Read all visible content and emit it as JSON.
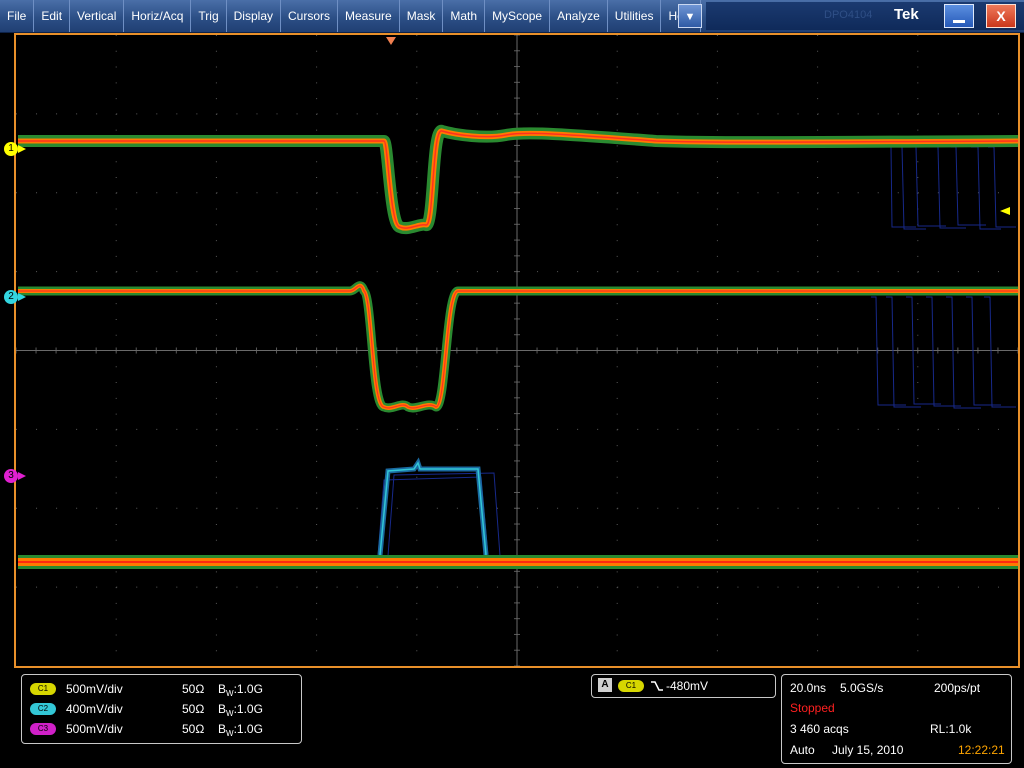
{
  "menu": {
    "items": [
      "File",
      "Edit",
      "Vertical",
      "Horiz/Acq",
      "Trig",
      "Display",
      "Cursors",
      "Measure",
      "Mask",
      "Math",
      "MyScope",
      "Analyze",
      "Utilities",
      "Help"
    ],
    "dropdown_icon": "chevron-down-icon",
    "ghost_text": "DPO4104",
    "brand": "Tek",
    "minimize_icon": "minimize-icon",
    "close_label": "X"
  },
  "channels": {
    "markers": [
      {
        "label": "1",
        "color": "#ffff00"
      },
      {
        "label": "2",
        "color": "#33d6e0"
      },
      {
        "label": "3",
        "color": "#e020d0"
      }
    ],
    "list": [
      {
        "badge": "C1",
        "color": "#d6d600",
        "scale": "500mV/div",
        "impedance": "50Ω",
        "bw_prefix": "B",
        "bw_sub": "W",
        "bw_value": ":1.0G"
      },
      {
        "badge": "C2",
        "color": "#33c7d6",
        "scale": "400mV/div",
        "impedance": "50Ω",
        "bw_prefix": "B",
        "bw_sub": "W",
        "bw_value": ":1.0G"
      },
      {
        "badge": "C3",
        "color": "#d020c8",
        "scale": "500mV/div",
        "impedance": "50Ω",
        "bw_prefix": "B",
        "bw_sub": "W",
        "bw_value": ":1.0G"
      }
    ]
  },
  "trigger": {
    "mode_letter": "A",
    "source": "C1",
    "slope_icon": "falling-edge-icon",
    "level": "-480mV"
  },
  "acquisition": {
    "time_div": "20.0ns",
    "sample_rate": "5.0GS/s",
    "resolution": "200ps/pt",
    "state": "Stopped",
    "acqs": "3 460 acqs",
    "record_length": "RL:1.0k",
    "trigger_mode": "Auto",
    "date": "July 15, 2010",
    "time": "12:22:21"
  },
  "colors": {
    "accent_orange": "#e8902a",
    "stopped_red": "#ff2020",
    "time_orange": "#ffa500"
  }
}
